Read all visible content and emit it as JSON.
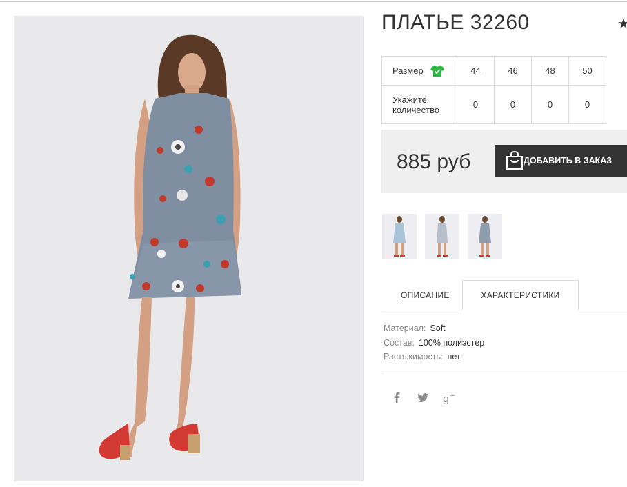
{
  "product": {
    "title": "ПЛАТЬЕ 32260"
  },
  "size_table": {
    "size_label": "Размер",
    "quantity_label": "Укажите количество",
    "sizes": [
      "44",
      "46",
      "48",
      "50"
    ],
    "quantities": [
      "0",
      "0",
      "0",
      "0"
    ]
  },
  "purchase": {
    "price": "885 руб",
    "add_to_cart_label": "ДОБАВИТЬ В ЗАКАЗ"
  },
  "tabs": {
    "description": "ОПИСАНИЕ",
    "characteristics": "ХАРАКТЕРИСТИКИ",
    "active": "characteristics"
  },
  "specs": [
    {
      "key": "Материал:",
      "value": "Soft"
    },
    {
      "key": "Состав:",
      "value": "100% полиэстер"
    },
    {
      "key": "Растяжимость:",
      "value": "нет"
    }
  ],
  "icons": {
    "favorite": "star-icon",
    "size_guide": "shirt-check-icon",
    "cart": "shopping-bag-icon",
    "social": [
      "facebook-icon",
      "twitter-icon",
      "google-plus-icon"
    ]
  },
  "colors": {
    "accent_green": "#2db742",
    "button_dark": "#333333",
    "price_box_bg": "#efefef"
  }
}
